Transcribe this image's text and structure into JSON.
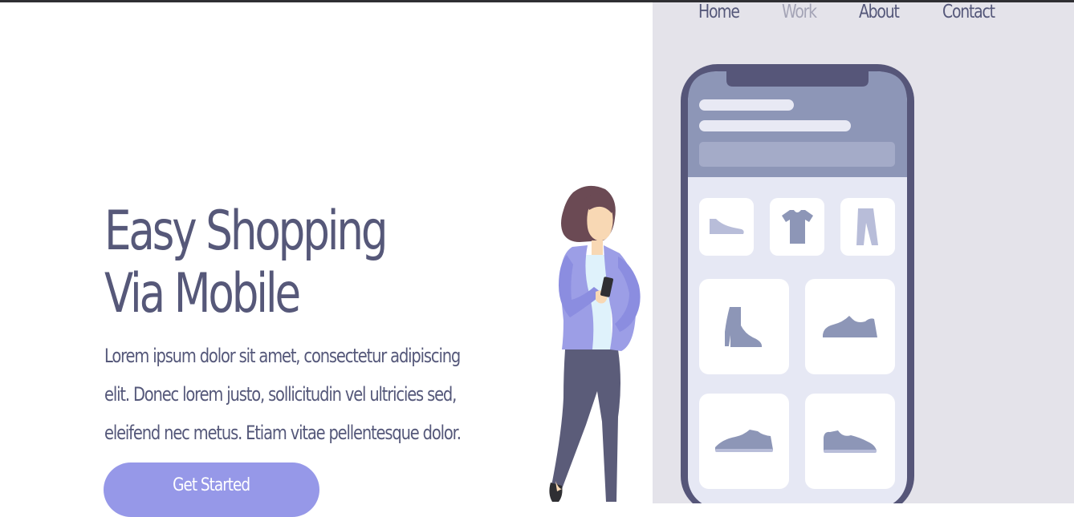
{
  "nav": {
    "items": [
      {
        "label": "Home",
        "active": false
      },
      {
        "label": "Work",
        "active": true
      },
      {
        "label": "About",
        "active": false
      },
      {
        "label": "Contact",
        "active": false
      }
    ]
  },
  "hero": {
    "title_line1": "Easy Shopping",
    "title_line2": "Via Mobile",
    "description_lines": [
      "Lorem ipsum dolor sit amet, consectetur adipiscing",
      "elit. Donec lorem justo, sollicitudin vel ultricies sed,",
      "eleifend nec metus. Etiam vitae pellentesque dolor."
    ],
    "cta_label": "Get Started"
  },
  "illustration": {
    "phone_app_icons": [
      "flat-shoe-icon",
      "tshirt-icon",
      "pants-icon",
      "heel-boot-icon",
      "sneaker-icon",
      "sneaker-icon",
      "sneaker-icon"
    ]
  },
  "colors": {
    "accent": "#9698e8",
    "text_primary": "#565879",
    "nav_active": "#a4a4b6",
    "panel_bg": "#e4e3ea",
    "phone_frame": "#565679",
    "phone_header": "#8d96b7"
  }
}
